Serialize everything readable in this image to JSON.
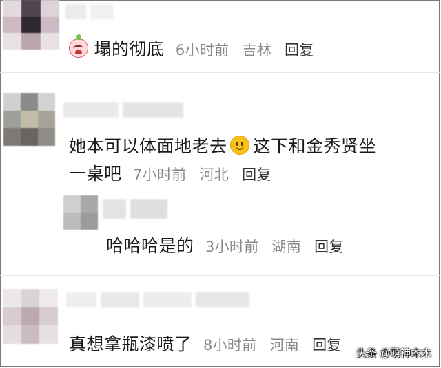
{
  "comments": [
    {
      "text": "塌的彻底",
      "emoji_before": "crying-emoji",
      "time": "6小时前",
      "location": "吉林",
      "reply": "回复"
    },
    {
      "text_part1": "她本可以体面地老去",
      "emoji_mid": "smile-emoji",
      "text_part2": "这下和金秀贤坐",
      "text_line2": "一桌吧",
      "time": "7小时前",
      "location": "河北",
      "reply": "回复"
    },
    {
      "text": "哈哈哈是的",
      "time": "3小时前",
      "location": "湖南",
      "reply": "回复"
    },
    {
      "text": "真想拿瓶漆喷了",
      "time": "8小时前",
      "location": "河南",
      "reply": "回复"
    }
  ],
  "watermark": "头条 @萌神木木"
}
